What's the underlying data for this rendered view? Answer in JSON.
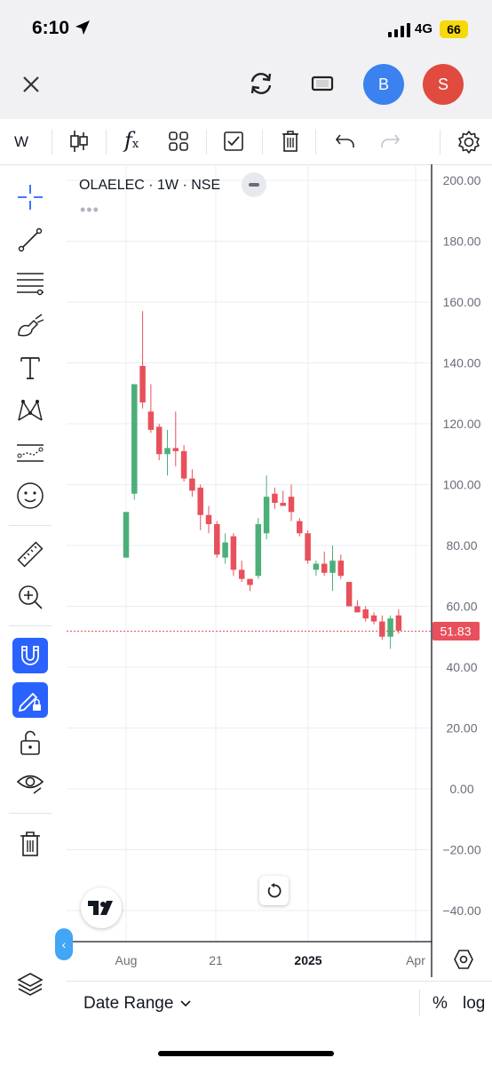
{
  "status_bar": {
    "time": "6:10",
    "network": "4G",
    "battery": "66"
  },
  "header": {
    "avatar_b": "B",
    "avatar_s": "S"
  },
  "toolbar": {
    "interval": "W"
  },
  "chart_data": {
    "type": "candlestick",
    "legend": "OLAELEC · 1W · NSE",
    "last_price": "51.83",
    "ylim": [
      -45,
      205
    ],
    "yticks": [
      "200.00",
      "180.00",
      "160.00",
      "140.00",
      "120.00",
      "100.00",
      "80.00",
      "60.00",
      "40.00",
      "20.00",
      "0.00",
      "−20.00",
      "−40.00"
    ],
    "xticks": [
      "Aug",
      "21",
      "2025",
      "Apr"
    ],
    "colors": {
      "up": "#4caf7a",
      "down": "#e8505b"
    },
    "candles": [
      {
        "o": 76,
        "h": 91,
        "l": 76,
        "c": 91
      },
      {
        "o": 97,
        "h": 133,
        "l": 95,
        "c": 133
      },
      {
        "o": 139,
        "h": 157,
        "l": 125,
        "c": 127
      },
      {
        "o": 124,
        "h": 133,
        "l": 117,
        "c": 118
      },
      {
        "o": 119,
        "h": 120,
        "l": 108,
        "c": 110
      },
      {
        "o": 110,
        "h": 118,
        "l": 103,
        "c": 112
      },
      {
        "o": 112,
        "h": 124,
        "l": 106,
        "c": 111
      },
      {
        "o": 111,
        "h": 113,
        "l": 101,
        "c": 102
      },
      {
        "o": 102,
        "h": 105,
        "l": 96,
        "c": 98
      },
      {
        "o": 99,
        "h": 100,
        "l": 85,
        "c": 90
      },
      {
        "o": 90,
        "h": 93,
        "l": 84,
        "c": 87
      },
      {
        "o": 87,
        "h": 88,
        "l": 76,
        "c": 77
      },
      {
        "o": 76,
        "h": 84,
        "l": 74,
        "c": 81
      },
      {
        "o": 83,
        "h": 84,
        "l": 70,
        "c": 72
      },
      {
        "o": 72,
        "h": 75,
        "l": 68,
        "c": 69
      },
      {
        "o": 69,
        "h": 69,
        "l": 65,
        "c": 67
      },
      {
        "o": 70,
        "h": 89,
        "l": 69,
        "c": 87
      },
      {
        "o": 84,
        "h": 103,
        "l": 82,
        "c": 96
      },
      {
        "o": 97,
        "h": 99,
        "l": 92,
        "c": 94
      },
      {
        "o": 94,
        "h": 98,
        "l": 93,
        "c": 93
      },
      {
        "o": 96,
        "h": 100,
        "l": 88,
        "c": 91
      },
      {
        "o": 88,
        "h": 89,
        "l": 83,
        "c": 84
      },
      {
        "o": 84,
        "h": 85,
        "l": 74,
        "c": 75
      },
      {
        "o": 72,
        "h": 75,
        "l": 70,
        "c": 74
      },
      {
        "o": 74,
        "h": 78,
        "l": 70,
        "c": 71
      },
      {
        "o": 71,
        "h": 80,
        "l": 65,
        "c": 75
      },
      {
        "o": 75,
        "h": 77,
        "l": 69,
        "c": 70
      },
      {
        "o": 68,
        "h": 68,
        "l": 60,
        "c": 60
      },
      {
        "o": 60,
        "h": 62,
        "l": 58,
        "c": 58
      },
      {
        "o": 59,
        "h": 60,
        "l": 55,
        "c": 56
      },
      {
        "o": 57,
        "h": 58,
        "l": 54,
        "c": 55
      },
      {
        "o": 55,
        "h": 57,
        "l": 49,
        "c": 50
      },
      {
        "o": 50,
        "h": 57,
        "l": 46,
        "c": 56
      },
      {
        "o": 57,
        "h": 59,
        "l": 51,
        "c": 52
      }
    ]
  },
  "bottom_bar": {
    "date_range": "Date Range",
    "percent": "%",
    "log": "log"
  }
}
